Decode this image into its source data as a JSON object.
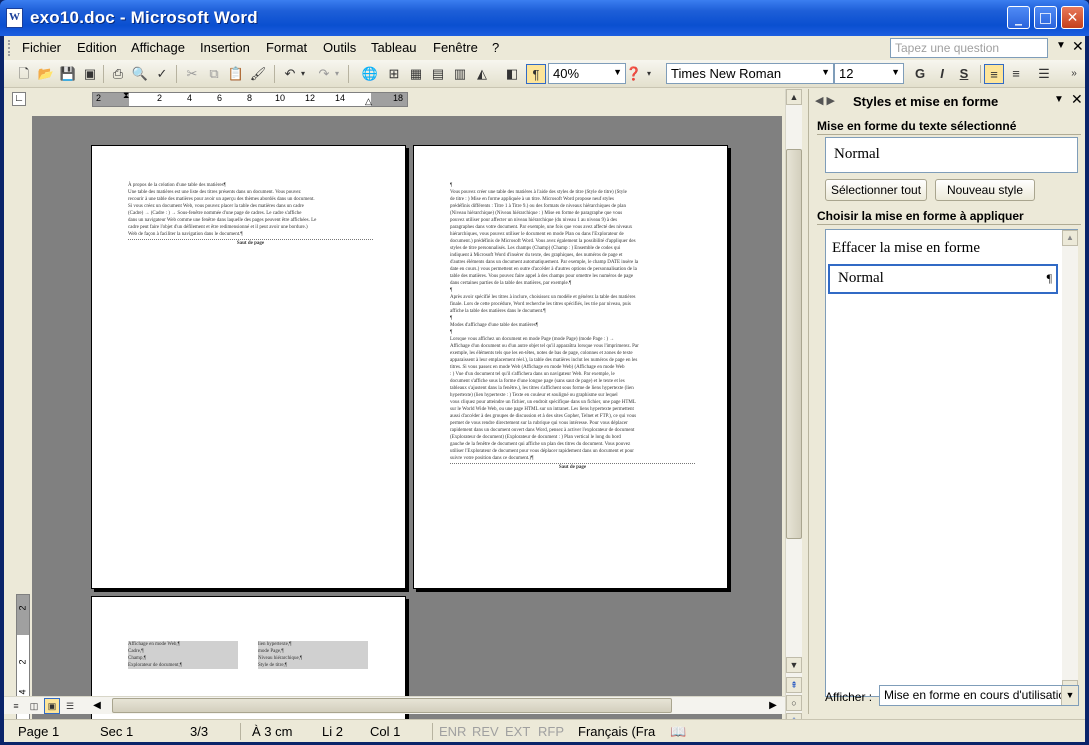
{
  "window": {
    "title": "exo10.doc - Microsoft Word"
  },
  "menu": {
    "items": [
      {
        "label": "Fichier"
      },
      {
        "label": "Edition"
      },
      {
        "label": "Affichage"
      },
      {
        "label": "Insertion"
      },
      {
        "label": "Format"
      },
      {
        "label": "Outils"
      },
      {
        "label": "Tableau"
      },
      {
        "label": "Fenêtre"
      },
      {
        "label": "?"
      }
    ],
    "help_placeholder": "Tapez une question"
  },
  "toolbar": {
    "zoom": "40%",
    "font_name": "Times New Roman",
    "font_size": "12",
    "bold": "G",
    "italic": "I",
    "underline": "S",
    "pilcrow": "¶"
  },
  "ruler": {
    "ticks": [
      "2",
      "2",
      "4",
      "6",
      "8",
      "10",
      "12",
      "14",
      "18"
    ]
  },
  "vruler": {
    "ticks": [
      "2",
      "2",
      "4"
    ]
  },
  "document": {
    "page1_lines": [
      "À propos de la création d'une table des matières¶",
      "Une table des matières est une liste des titres présents dans un document. Vous pouvez",
      "recourir à une table des matières pour avoir un aperçu des thèmes abordés dans un document.",
      "Si vous créez un document Web, vous pouvez placer la table des matières dans un cadre",
      "(Cadre) → (Cadre : ) → Sous-fenêtre nommée d'une page de cadres. Le cadre s'affiche",
      "dans un navigateur Web comme une fenêtre dans laquelle des pages peuvent être affichées. Le",
      "cadre peut faire l'objet d'un défilement et être redimensionné et il peut avoir une bordure.)",
      "Web de façon à faciliter la navigation dans le document.¶"
    ],
    "page1_break": "Saut de page",
    "page2_lines": [
      "¶",
      "Vous pouvez créer une table des matières à l'aide des styles de titre (Style de titre) (Style",
      "de titre : ) Mise en forme appliquée à un titre. Microsoft Word propose neuf styles",
      "prédéfinis différents : Titre 1 à Titre 9.) ou des formats de niveaux hiérarchiques de plan",
      "(Niveau hiérarchique) (Niveau hiérarchique : ) Mise en forme de paragraphe que vous",
      "pouvez utiliser pour affecter un niveau hiérarchique (du niveau 1 au niveau 9) à des",
      "paragraphes dans votre document. Par exemple, une fois que vous avez affecté des niveaux",
      "hiérarchiques, vous pouvez utiliser le document en mode Plan ou dans l'Explorateur de",
      "document.) prédéfinis de Microsoft Word. Vous avez également la possibilité d'appliquer des",
      "styles de titre personnalisés. Les champs (Champ) (Champ : ) Ensemble de codes qui",
      "indiquent à Microsoft Word d'insérer du texte, des graphiques, des numéros de page et",
      "d'autres éléments dans un document automatiquement. Par exemple, le champ DATE insère la",
      "date en cours.) vous permettent en outre d'accéder à d'autres options de personnalisation de la",
      "table des matières. Vous pouvez faire appel à des champs pour omettre les numéros de page",
      "dans certaines parties de la table des matières, par exemple.¶",
      "¶",
      "Après avoir spécifié les titres à inclure, choisissez un modèle et générez la table des matières",
      "finale. Lors de cette procédure, Word recherche les titres spécifiés, les trie par niveau, puis",
      "affiche la table des matières dans le document.¶",
      "¶",
      "Modes d'affichage d'une table des matières¶",
      "¶",
      "Lorsque vous affichez un document en mode Page (mode Page) (mode Page : ) →",
      "Affichage d'un document ou d'un autre objet tel qu'il apparaîtra lorsque vous l'imprimerez. Par",
      "exemple, les éléments tels que les en-têtes, notes de bas de page, colonnes et zones de texte",
      "apparaissent à leur emplacement réel.), la table des matières inclut les numéros de page en les",
      "titres. Si vous passez en mode Web (Affichage en mode Web) (Affichage en mode Web",
      ": ) Vue d'un document tel qu'il s'affichera dans un navigateur Web. Par exemple, le",
      "document s'affiche sous la forme d'une longue page (sans saut de page) et le texte et les",
      "tableaux s'ajustent dans la fenêtre.), les titres s'affichent sous forme de liens hypertexte (lien",
      "hypertexte) (lien hypertexte : ) Texte en couleur et souligné ou graphisme sur lequel",
      "vous cliquez pour atteindre un fichier, un endroit spécifique dans un fichier, une page HTML",
      "sur le World Wide Web, ou une page HTML sur un intranet. Les liens hypertexte permettent",
      "aussi d'accéder à des groupes de discussion et à des sites Gopher, Telnet et FTP.), ce qui vous",
      "permet de vous rendre directement sur la rubrique qui vous intéresse. Pour vous déplacer",
      "rapidement dans un document ouvert dans Word, pensez à activer l'explorateur de document",
      "(Explorateur de document) (Explorateur de document : ) Plan vertical le long du bord",
      "gauche de la fenêtre de document qui affiche un plan des titres du document. Vous pouvez",
      "utiliser l'Explorateur de document pour vous déplacer rapidement dans un document et pour",
      "suivre votre position dans ce document.)¶"
    ],
    "page2_break": "Saut de page",
    "page3_left": [
      "Affichage en mode Web,¶",
      "Cadre,¶",
      "Champ,¶",
      "Explorateur de document,¶"
    ],
    "page3_right": [
      "lien hypertexte,¶",
      "mode Page,¶",
      "Niveau hiérarchique,¶",
      "Style de titre,¶"
    ]
  },
  "taskpane": {
    "title": "Styles et mise en forme",
    "section_selected": "Mise en forme du texte sélectionné",
    "selected_style": "Normal",
    "select_all_button": "Sélectionner tout",
    "new_style_button": "Nouveau style",
    "section_apply": "Choisir la mise en forme à appliquer",
    "styles": [
      {
        "label": "Effacer la mise en forme"
      },
      {
        "label": "Normal"
      }
    ],
    "normal_mark": "¶",
    "show_label": "Afficher :",
    "show_value": "Mise en forme en cours d'utilisation"
  },
  "status": {
    "page": "Page 1",
    "section": "Sec 1",
    "pages": "3/3",
    "position": "À 3 cm",
    "line": "Li 2",
    "col": "Col 1",
    "enr": "ENR",
    "rev": "REV",
    "ext": "EXT",
    "rfp": "RFP",
    "language": "Français (Fra"
  },
  "colors": {
    "titlebar": "#0a4fd0",
    "chrome": "#ece9d8",
    "workspace": "#808080",
    "selection_border": "#316ac5"
  }
}
